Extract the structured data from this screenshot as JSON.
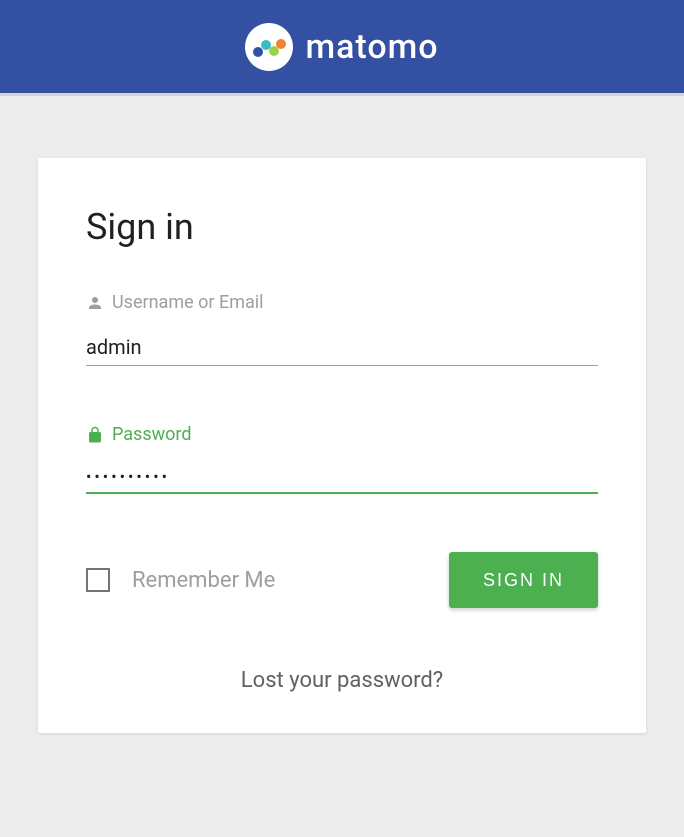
{
  "header": {
    "brand": "matomo"
  },
  "form": {
    "title": "Sign in",
    "username": {
      "label": "Username or Email",
      "value": "admin"
    },
    "password": {
      "label": "Password",
      "value": "••••••••••"
    },
    "remember_label": "Remember Me",
    "submit_label": "SIGN IN",
    "forgot_label": "Lost your password?"
  }
}
